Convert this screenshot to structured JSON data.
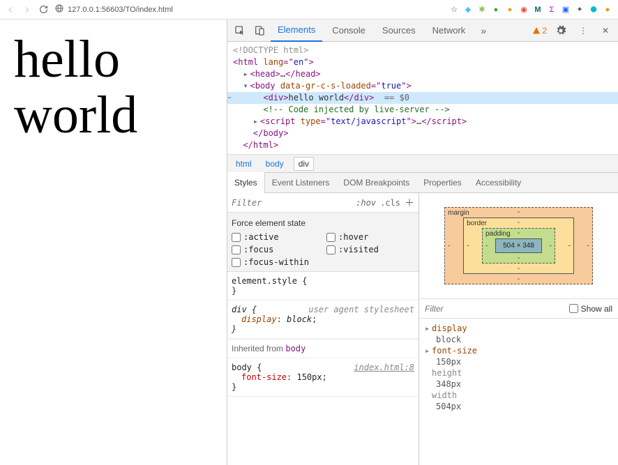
{
  "browser": {
    "url": "127.0.0.1:56603/TO/index.html",
    "ext_colors": [
      "#555",
      "#4fc3f7",
      "#8bc34a",
      "#43a047",
      "#ff9800",
      "#f44336",
      "#00695c",
      "#8e24aa",
      "#2962ff",
      "#2e7d32",
      "#455a64",
      "#00bcd4",
      "#fb8c00"
    ]
  },
  "page": {
    "content": "hello world"
  },
  "devtools": {
    "tabs": {
      "elements": "Elements",
      "console": "Console",
      "sources": "Sources",
      "network": "Network"
    },
    "warn_count": "2",
    "dom": {
      "doctype": "<!DOCTYPE html>",
      "html_open_a": "html",
      "html_lang_attr": "lang",
      "html_lang_val": "en",
      "head_name": "head",
      "head_ellipsis": "…",
      "body_name": "body",
      "body_attr": "data-gr-c-s-loaded",
      "body_val": "true",
      "div_name": "div",
      "div_text": "hello world",
      "eq0": "== $0",
      "comment": "<!-- Code injected by live-server -->",
      "script_name": "script",
      "script_attr": "type",
      "script_val": "text/javascript",
      "script_ellipsis": "…"
    },
    "breadcrumbs": {
      "a": "html",
      "b": "body",
      "c": "div"
    },
    "subtabs": {
      "styles": "Styles",
      "evt": "Event Listeners",
      "domb": "DOM Breakpoints",
      "props": "Properties",
      "acc": "Accessibility"
    },
    "filter": {
      "placeholder": "Filter",
      "hov": ":hov",
      "cls": ".cls"
    },
    "force_state": {
      "title": "Force element state",
      "active": ":active",
      "hover": ":hover",
      "focus": ":focus",
      "visited": ":visited",
      "focuswithin": ":focus-within"
    },
    "styles": {
      "elstyle_sel": "element.style {",
      "elstyle_close": "}",
      "div_sel": "div {",
      "ua": "user agent stylesheet",
      "div_prop": "display",
      "div_val": "block",
      "div_close": "}",
      "inherited": "Inherited from",
      "inherited_from": "body",
      "body_sel": "body {",
      "body_src": "index.html:8",
      "body_prop": "font-size",
      "body_val": "150px",
      "body_close": "}"
    },
    "boxmodel": {
      "margin": "margin",
      "border": "border",
      "padding": "padding",
      "content": "504 × 348",
      "dash": "-"
    },
    "computed_filter": {
      "placeholder": "Filter",
      "showall": "Show all"
    },
    "computed": {
      "display_k": "display",
      "display_v": "block",
      "fontsize_k": "font-size",
      "fontsize_v": "150px",
      "height_k": "height",
      "height_v": "348px",
      "width_k": "width",
      "width_v": "504px"
    }
  }
}
